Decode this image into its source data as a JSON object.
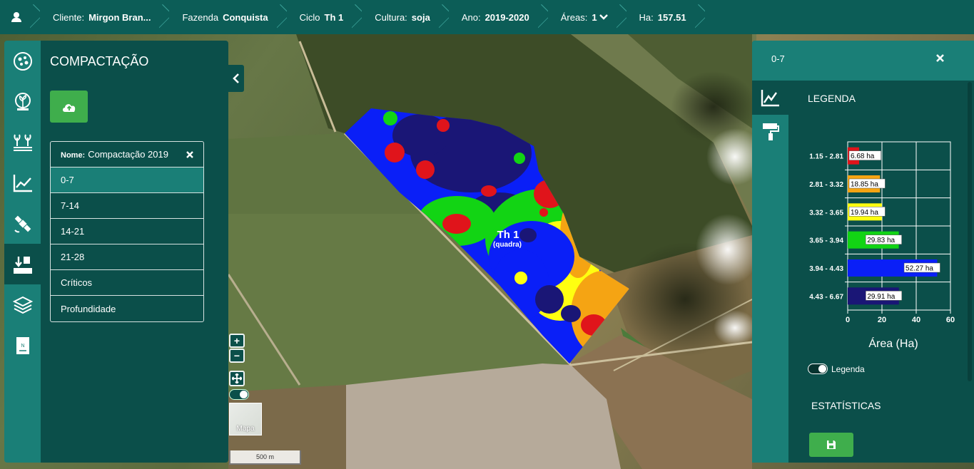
{
  "breadcrumb": {
    "user_icon": "user-icon",
    "cliente": {
      "label": "Cliente:",
      "value": "Mirgon Bran..."
    },
    "fazenda": {
      "label": "Fazenda",
      "value": "Conquista"
    },
    "ciclo": {
      "label": "Ciclo",
      "value": "Th 1"
    },
    "cultura": {
      "label": "Cultura:",
      "value": "soja"
    },
    "ano": {
      "label": "Ano:",
      "value": "2019-2020"
    },
    "areas": {
      "label": "Áreas:",
      "value": "1"
    },
    "ha": {
      "label": "Ha:",
      "value": "157.51"
    }
  },
  "sidebar": {
    "icons": [
      "fields-icon",
      "seed-icon",
      "crop-icon",
      "chart-icon",
      "satellite-icon",
      "soil-compaction-icon",
      "layers-icon",
      "map-document-icon"
    ],
    "active_index": 5
  },
  "left_panel": {
    "title": "COMPACTAÇÃO",
    "upload_icon": "cloud-upload-icon",
    "name_label": "Nome:",
    "name_value": "Compactação 2019",
    "items": [
      "0-7",
      "7-14",
      "14-21",
      "21-28",
      "Críticos",
      "Profundidade"
    ],
    "selected_item": "0-7"
  },
  "map": {
    "field_label": "Th 1",
    "field_sublabel": "(quadra)",
    "zoom_in": "+",
    "zoom_out": "−",
    "basemap_label": "Mapa",
    "scale_label": "500 m"
  },
  "right_panel": {
    "title": "0-7",
    "legend_title": "LEGENDA",
    "legend_toggle_label": "Legenda",
    "stats_title": "ESTATÍSTICAS",
    "tabs": [
      "chart-icon",
      "paint-roller-icon"
    ]
  },
  "chart_data": {
    "type": "bar",
    "orientation": "horizontal",
    "categories": [
      "1.15 - 2.81",
      "2.81 - 3.32",
      "3.32 - 3.65",
      "3.65 - 3.94",
      "3.94 - 4.43",
      "4.43 - 6.67"
    ],
    "values": [
      6.68,
      18.85,
      19.94,
      29.83,
      52.27,
      29.91
    ],
    "value_labels": [
      "6.68 ha",
      "18.85 ha",
      "19.94 ha",
      "29.83 ha",
      "52.27 ha",
      "29.91 ha"
    ],
    "colors": [
      "#e0141b",
      "#f5a413",
      "#ffff10",
      "#12d414",
      "#0a1ff7",
      "#1a1676"
    ],
    "xlabel": "Área (Ha)",
    "xlim": [
      0,
      60
    ],
    "xticks": [
      "0",
      "20",
      "40",
      "60"
    ],
    "grid": true
  },
  "colors": {
    "bar_bg": "#0c5d57",
    "panel_bg": "#0b4f4a",
    "accent": "#1a7f77",
    "button_green": "#3fae4c"
  }
}
